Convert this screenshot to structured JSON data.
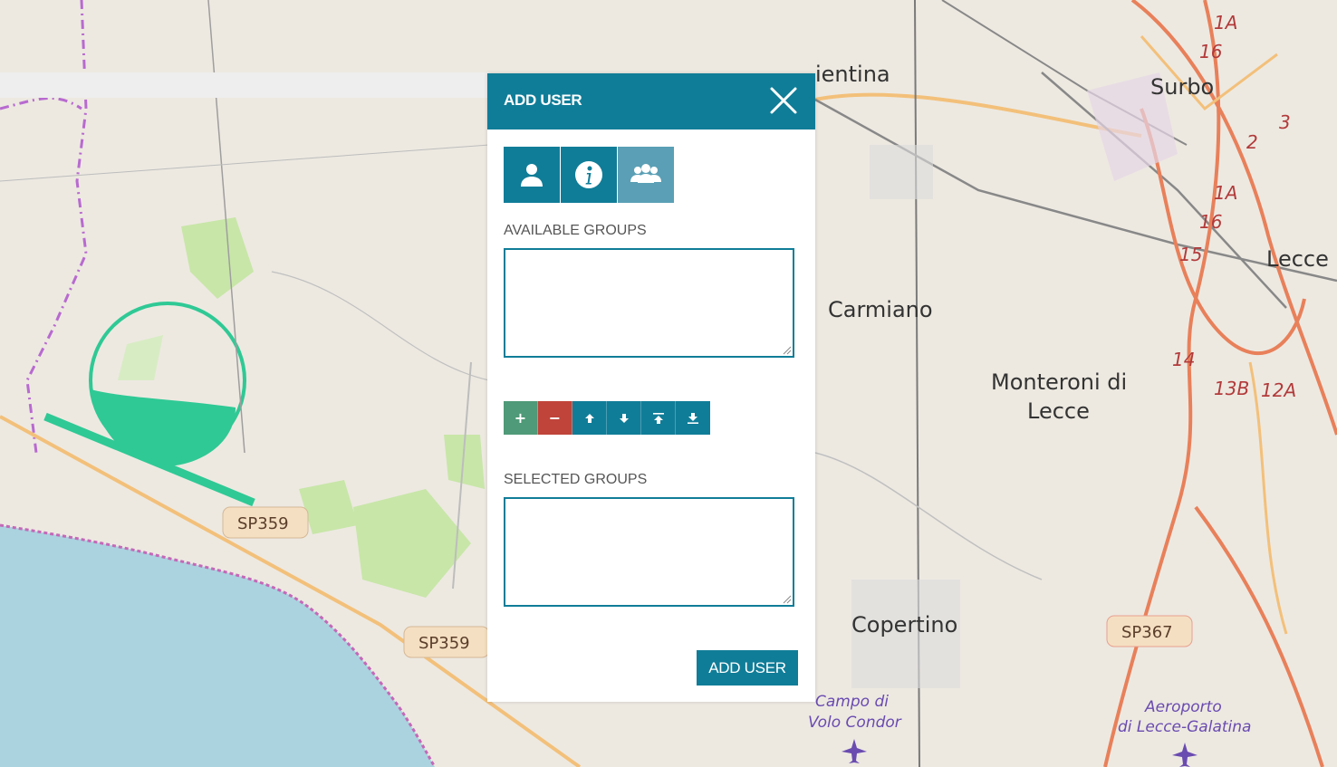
{
  "map": {
    "towns": [
      "Surbo",
      "Lecce",
      "Carmiano",
      "Monteroni di",
      "Lecce",
      "Copertino",
      "ientina"
    ],
    "road_shields": [
      "SP359",
      "SP359",
      "SP367"
    ],
    "road_refs": [
      "1A",
      "16",
      "3",
      "2",
      "1A",
      "16",
      "15",
      "14",
      "13B",
      "12A"
    ],
    "poi": [
      "Campo di",
      "Volo Condor",
      "Aeroporto",
      "di Lecce-Galatina"
    ],
    "colors": {
      "land": "#ede9e1",
      "sea": "#aad3df",
      "park": "#c8e6a8",
      "highlight": "#2fc995",
      "major_road": "#e8805a",
      "boundary": "#b86ad0"
    }
  },
  "dialog": {
    "title": "ADD USER",
    "close_icon": "close-icon",
    "tabs": [
      {
        "icon": "user-icon",
        "active": false
      },
      {
        "icon": "info-icon",
        "active": false
      },
      {
        "icon": "group-icon",
        "active": true
      }
    ],
    "available_label": "AVAILABLE GROUPS",
    "selected_label": "SELECTED GROUPS",
    "toolbar": [
      {
        "icon": "plus-icon",
        "glyph": "+"
      },
      {
        "icon": "minus-icon",
        "glyph": "−"
      },
      {
        "icon": "arrow-up-icon",
        "glyph": ""
      },
      {
        "icon": "arrow-down-icon",
        "glyph": ""
      },
      {
        "icon": "move-top-icon",
        "glyph": ""
      },
      {
        "icon": "move-bottom-icon",
        "glyph": ""
      }
    ],
    "submit_label": "ADD USER",
    "colors": {
      "primary": "#107d98",
      "tab_active": "#5a9fb5",
      "add": "#4f9a78",
      "remove": "#c0443a"
    }
  }
}
